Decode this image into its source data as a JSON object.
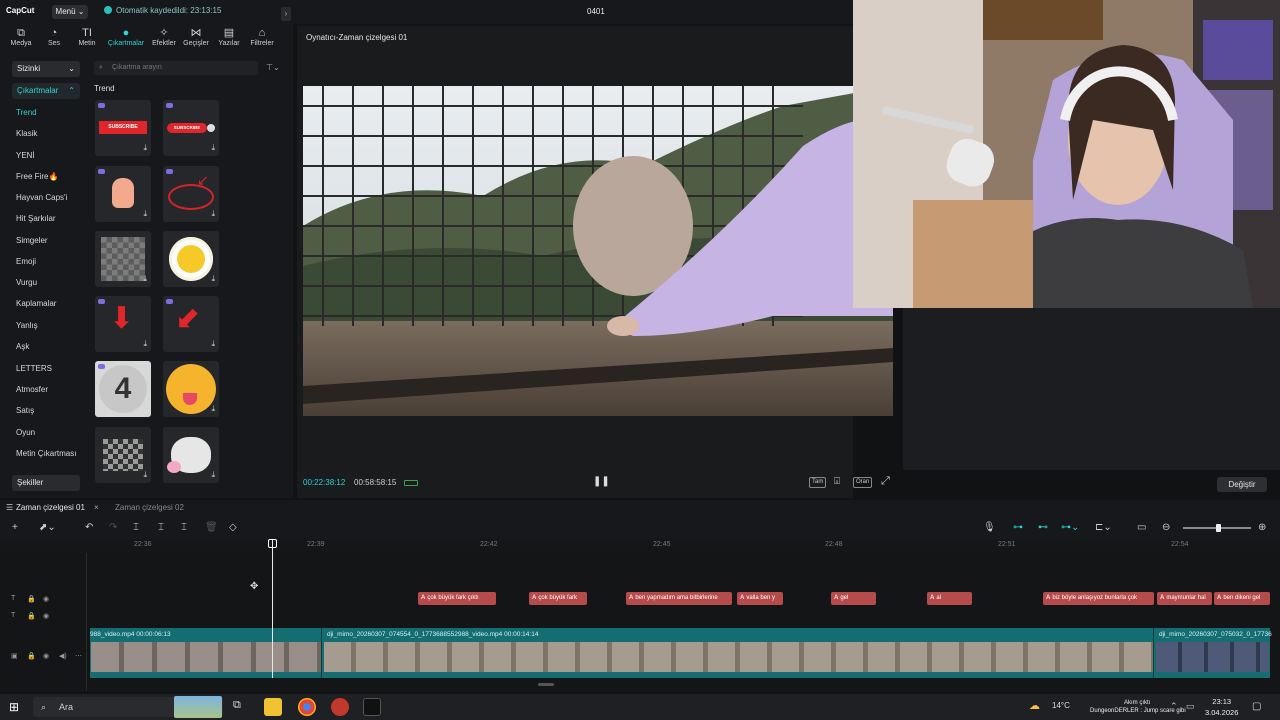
{
  "topbar": {
    "logo": "CapCut",
    "menu_label": "Menü ⌄",
    "autosave": "Otomatik kaydedildi: 23:13:15",
    "project_title": "0401"
  },
  "tool_tabs": [
    {
      "label": "Medya",
      "icon": "media-icon"
    },
    {
      "label": "Ses",
      "icon": "audio-icon"
    },
    {
      "label": "Metin",
      "icon": "text-icon"
    },
    {
      "label": "Çıkartmalar",
      "icon": "stickers-icon",
      "active": true
    },
    {
      "label": "Efektler",
      "icon": "effects-icon"
    },
    {
      "label": "Geçişler",
      "icon": "transitions-icon"
    },
    {
      "label": "Yazılar",
      "icon": "captions-icon"
    },
    {
      "label": "Filtreler",
      "icon": "filters-icon"
    }
  ],
  "categories": {
    "yours": "Sizinki",
    "stickers": "Çıkartmalar",
    "items": [
      "Trend",
      "Klasik",
      "YENİ",
      "Free Fire🔥",
      "Hayvan Caps'i",
      "Hit Şarkılar",
      "Simgeler",
      "Emoji",
      "Vurgu",
      "Kaplamalar",
      "Yanlış",
      "Aşk",
      "LETTERS",
      "Atmosfer",
      "Satış",
      "Oyun",
      "Metin Çıkartması"
    ],
    "active_item": "Trend",
    "shapes": "Şekiller"
  },
  "sticker_panel": {
    "search_placeholder": "Çıkartma arayın",
    "section_title": "Trend",
    "stickers": [
      {
        "name": "subscribe-red-sticker",
        "text": "SUBSCRIBE"
      },
      {
        "name": "subscribe-bell-sticker",
        "text": "SUBSCRIBE"
      },
      {
        "name": "hand-sticker",
        "text": ""
      },
      {
        "name": "red-circle-arrow-sticker",
        "text": ""
      },
      {
        "name": "pixel-blur-sticker",
        "text": ""
      },
      {
        "name": "smiling-flower-sticker",
        "text": ""
      },
      {
        "name": "red-down-arrow-sticker",
        "text": ""
      },
      {
        "name": "red-diagonal-arrow-sticker",
        "text": ""
      },
      {
        "name": "countdown-sticker",
        "text": "4"
      },
      {
        "name": "tongue-emoji-sticker",
        "text": ""
      },
      {
        "name": "pixel-mosaic-sticker",
        "text": ""
      },
      {
        "name": "cat-sticker",
        "text": ""
      }
    ]
  },
  "player": {
    "title": "Oynatıcı-Zaman çizelgesi 01",
    "current_time": "00:22:38:12",
    "total_time": "00:58:58:15",
    "full_label": "Tam",
    "ratio_label": "Oran"
  },
  "inspector": {
    "change_button": "Değiştir"
  },
  "timeline": {
    "tabs": [
      "Zaman çizelgesi 01",
      "Zaman çizelgesi 02"
    ],
    "ruler_ticks": [
      "22:36",
      "22:39",
      "22:42",
      "22:45",
      "22:48",
      "22:51",
      "22:54"
    ],
    "subtitles": [
      {
        "text": "çok büyük fark çıktı"
      },
      {
        "text": "çok büyük fark"
      },
      {
        "text": "ben yapmadım ama bitbirlerine"
      },
      {
        "text": "valla ben y"
      },
      {
        "text": "gel"
      },
      {
        "text": "al"
      },
      {
        "text": "biz böyle anlaşıyoz bunlarla çok"
      },
      {
        "text": "maymunlar hal"
      },
      {
        "text": "ben dikeni gel"
      }
    ],
    "video_clips": [
      {
        "label": "988_video.mp4   00:00:06:13"
      },
      {
        "label": "dji_mimo_20260307_074554_0_1773688552988_video.mp4   00:00:14:14"
      },
      {
        "label": "dji_mimo_20260307_075032_0_17736"
      }
    ]
  },
  "taskbar": {
    "search_label": "Ara",
    "weather": "14°C",
    "news_line1": "Akım çıktı",
    "news_line2": "DungeonDERLER : Jump scare gibi",
    "time": "23:13",
    "date": "3.04.2026"
  },
  "colors": {
    "accent": "#2ed3d3",
    "subtitle_clip": "#b64b4b",
    "video_clip": "#146d70"
  }
}
